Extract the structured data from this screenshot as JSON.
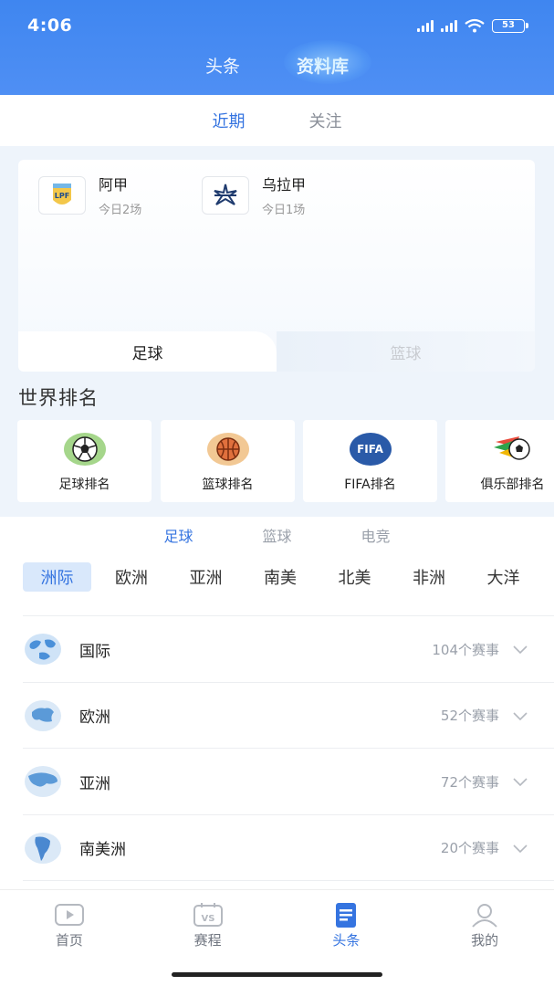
{
  "status": {
    "time": "4:06",
    "battery": "53"
  },
  "top_tabs": [
    {
      "label": "头条",
      "active": false
    },
    {
      "label": "资料库",
      "active": true
    }
  ],
  "sub_tabs": [
    {
      "label": "近期",
      "active": true
    },
    {
      "label": "关注",
      "active": false
    }
  ],
  "leagues": [
    {
      "name": "阿甲",
      "today": "今日2场",
      "logo_text": "LPF"
    },
    {
      "name": "乌拉甲",
      "today": "今日1场",
      "logo_text": "★"
    }
  ],
  "card_tabs": [
    {
      "label": "足球",
      "active": true
    },
    {
      "label": "篮球",
      "active": false
    }
  ],
  "section_title": "世界排名",
  "rankings": [
    {
      "label": "足球排名",
      "icon": "soccer-ball-icon"
    },
    {
      "label": "篮球排名",
      "icon": "basketball-icon"
    },
    {
      "label": "FIFA排名",
      "icon": "fifa-logo-icon",
      "badge": "FIFA"
    },
    {
      "label": "俱乐部排名",
      "icon": "club-ball-icon"
    }
  ],
  "category_tabs": [
    {
      "label": "足球",
      "active": true
    },
    {
      "label": "篮球",
      "active": false
    },
    {
      "label": "电竞",
      "active": false
    }
  ],
  "regions": [
    {
      "label": "洲际",
      "active": true
    },
    {
      "label": "欧洲",
      "active": false
    },
    {
      "label": "亚洲",
      "active": false
    },
    {
      "label": "南美",
      "active": false
    },
    {
      "label": "北美",
      "active": false
    },
    {
      "label": "非洲",
      "active": false
    },
    {
      "label": "大洋",
      "active": false
    }
  ],
  "competitions": [
    {
      "name": "国际",
      "count": "104个赛事",
      "icon": "globe-icon"
    },
    {
      "name": "欧洲",
      "count": "52个赛事",
      "icon": "europe-map-icon"
    },
    {
      "name": "亚洲",
      "count": "72个赛事",
      "icon": "asia-map-icon"
    },
    {
      "name": "南美洲",
      "count": "20个赛事",
      "icon": "south-america-map-icon"
    }
  ],
  "bottom_nav": [
    {
      "label": "首页",
      "icon": "play-tv-icon",
      "active": false
    },
    {
      "label": "赛程",
      "icon": "vs-schedule-icon",
      "active": false
    },
    {
      "label": "头条",
      "icon": "news-document-icon",
      "active": true
    },
    {
      "label": "我的",
      "icon": "profile-icon",
      "active": false
    }
  ],
  "colors": {
    "header": "#4a8cf3",
    "accent": "#3574e0",
    "page_bg": "#eef4fb"
  }
}
